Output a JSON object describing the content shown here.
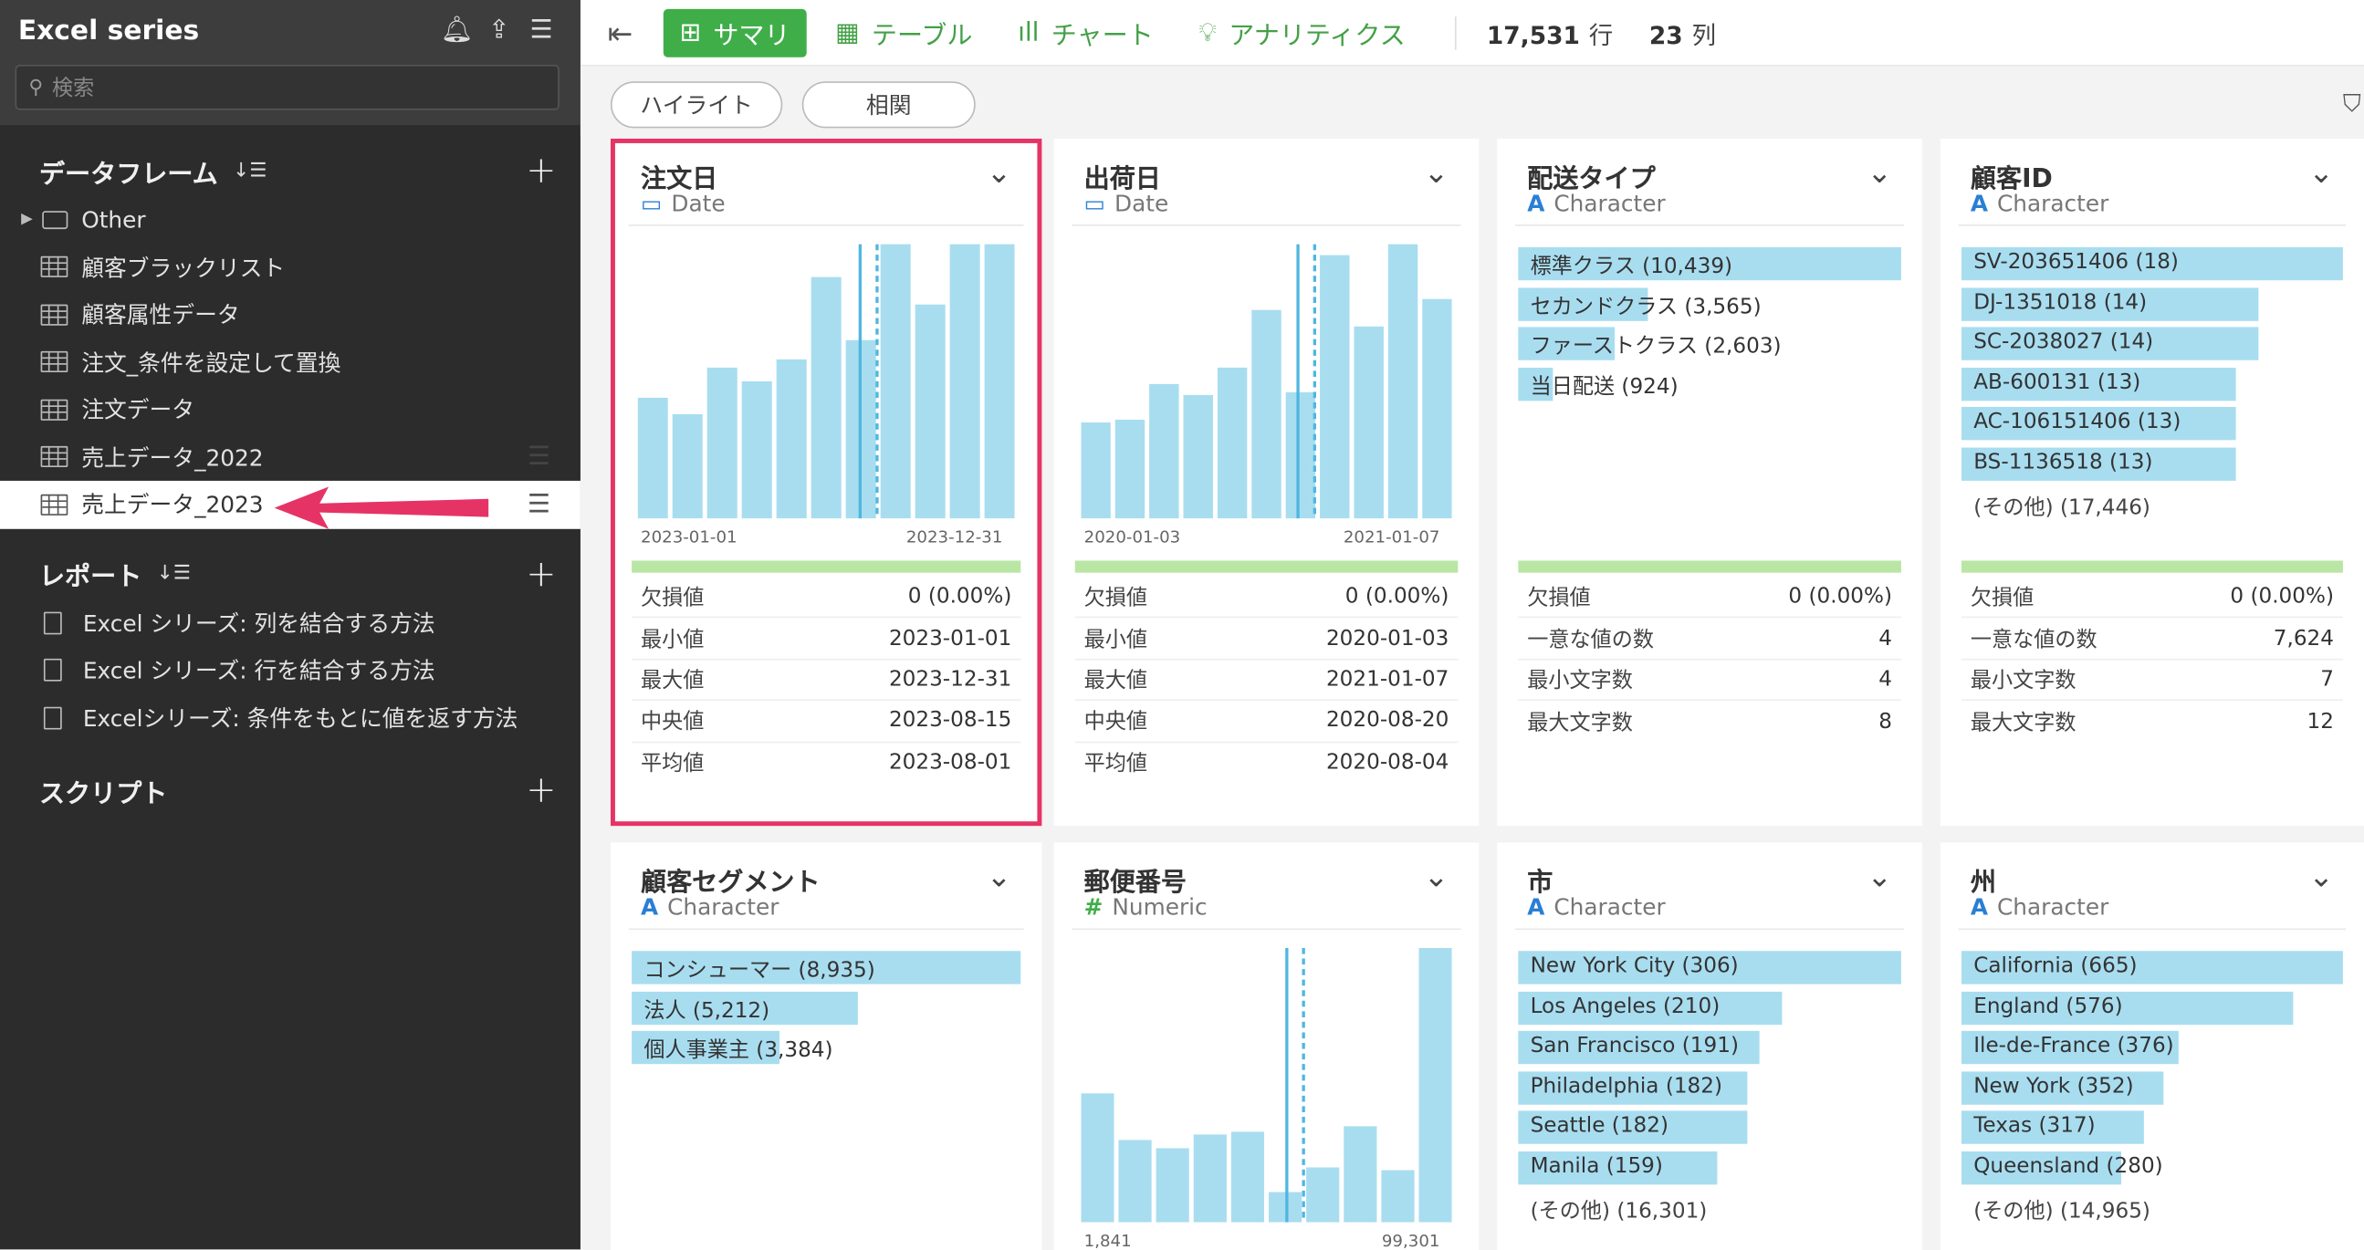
{
  "sidebar": {
    "title": "Excel series",
    "search_placeholder": "検索",
    "dataframes": {
      "title": "データフレーム",
      "items": [
        {
          "label": "Other",
          "kind": "folder"
        },
        {
          "label": "顧客ブラックリスト",
          "kind": "table"
        },
        {
          "label": "顧客属性データ",
          "kind": "table"
        },
        {
          "label": "注文_条件を設定して置換",
          "kind": "table"
        },
        {
          "label": "注文データ",
          "kind": "table"
        },
        {
          "label": "売上データ_2022",
          "kind": "table"
        },
        {
          "label": "売上データ_2023",
          "kind": "table",
          "active": true
        }
      ]
    },
    "reports": {
      "title": "レポート",
      "items": [
        {
          "label": "Excel シリーズ: 列を結合する方法"
        },
        {
          "label": "Excel シリーズ: 行を結合する方法"
        },
        {
          "label": "Excelシリーズ: 条件をもとに値を返す方法"
        }
      ]
    },
    "scripts": {
      "title": "スクリプト"
    }
  },
  "topbar": {
    "tabs": [
      {
        "label": "サマリ",
        "icon": "summary-icon",
        "active": true
      },
      {
        "label": "テーブル",
        "icon": "table-icon"
      },
      {
        "label": "チャート",
        "icon": "bar-chart-icon"
      },
      {
        "label": "アナリティクス",
        "icon": "lightbulb-icon"
      }
    ],
    "rows": "17,531",
    "rows_unit": "行",
    "cols": "23",
    "cols_unit": "列"
  },
  "subbar": {
    "highlight": "ハイライト",
    "correlation": "相関"
  },
  "colors": {
    "accent": "#3fae49",
    "bar": "#a8ddf0",
    "selected": "#e63366",
    "sidebar": "#2c2c2c"
  },
  "cards": [
    {
      "title": "注文日",
      "type": "Date",
      "type_icon": "calendar-icon",
      "hist": {
        "values": [
          44,
          38,
          55,
          50,
          58,
          88,
          65,
          100,
          78,
          100,
          100
        ],
        "median_frac": 0.59,
        "mean_frac": 0.635,
        "x_min": "2023-01-01",
        "x_max": "2023-12-31"
      },
      "stats": [
        {
          "label": "欠損値",
          "value": "0 (0.00%)"
        },
        {
          "label": "最小値",
          "value": "2023-01-01"
        },
        {
          "label": "最大値",
          "value": "2023-12-31"
        },
        {
          "label": "中央値",
          "value": "2023-08-15"
        },
        {
          "label": "平均値",
          "value": "2023-08-01"
        }
      ]
    },
    {
      "title": "出荷日",
      "type": "Date",
      "type_icon": "calendar-icon",
      "hist": {
        "values": [
          35,
          36,
          49,
          45,
          55,
          76,
          46,
          96,
          70,
          100,
          80
        ],
        "median_frac": 0.585,
        "mean_frac": 0.63,
        "x_min": "2020-01-03",
        "x_max": "2021-01-07"
      },
      "stats": [
        {
          "label": "欠損値",
          "value": "0 (0.00%)"
        },
        {
          "label": "最小値",
          "value": "2020-01-03"
        },
        {
          "label": "最大値",
          "value": "2021-01-07"
        },
        {
          "label": "中央値",
          "value": "2020-08-20"
        },
        {
          "label": "平均値",
          "value": "2020-08-04"
        }
      ]
    },
    {
      "title": "配送タイプ",
      "type": "Character",
      "type_icon": "character-icon",
      "categories": [
        {
          "label": "標準クラス (10,439)",
          "frac": 1.0
        },
        {
          "label": "セカンドクラス (3,565)",
          "frac": 0.34
        },
        {
          "label": "ファーストクラス (2,603)",
          "frac": 0.25
        },
        {
          "label": "当日配送 (924)",
          "frac": 0.09
        }
      ],
      "stats": [
        {
          "label": "欠損値",
          "value": "0 (0.00%)"
        },
        {
          "label": "一意な値の数",
          "value": "4"
        },
        {
          "label": "最小文字数",
          "value": "4"
        },
        {
          "label": "最大文字数",
          "value": "8"
        }
      ]
    },
    {
      "title": "顧客ID",
      "type": "Character",
      "type_icon": "character-icon",
      "categories": [
        {
          "label": "SV-203651406 (18)",
          "frac": 1.0
        },
        {
          "label": "DJ-1351018 (14)",
          "frac": 0.78
        },
        {
          "label": "SC-2038027 (14)",
          "frac": 0.78
        },
        {
          "label": "AB-600131 (13)",
          "frac": 0.72
        },
        {
          "label": "AC-106151406 (13)",
          "frac": 0.72
        },
        {
          "label": "BS-1136518 (13)",
          "frac": 0.72
        },
        {
          "label": "(その他) (17,446)",
          "frac": 0,
          "other": true
        }
      ],
      "stats": [
        {
          "label": "欠損値",
          "value": "0 (0.00%)"
        },
        {
          "label": "一意な値の数",
          "value": "7,624"
        },
        {
          "label": "最小文字数",
          "value": "7"
        },
        {
          "label": "最大文字数",
          "value": "12"
        }
      ]
    },
    {
      "title": "顧客セグメント",
      "type": "Character",
      "type_icon": "character-icon",
      "categories": [
        {
          "label": "コンシューマー (8,935)",
          "frac": 1.0
        },
        {
          "label": "法人 (5,212)",
          "frac": 0.58
        },
        {
          "label": "個人事業主 (3,384)",
          "frac": 0.38
        }
      ]
    },
    {
      "title": "郵便番号",
      "type": "Numeric",
      "type_icon": "hash-icon",
      "hist": {
        "values": [
          47,
          30,
          27,
          32,
          33,
          11,
          20,
          35,
          19,
          100
        ],
        "median_frac": 0.555,
        "mean_frac": 0.6,
        "x_min": "1,841",
        "x_max": "99,301"
      }
    },
    {
      "title": "市",
      "type": "Character",
      "type_icon": "character-icon",
      "categories": [
        {
          "label": "New York City (306)",
          "frac": 1.0
        },
        {
          "label": "Los Angeles (210)",
          "frac": 0.69
        },
        {
          "label": "San Francisco (191)",
          "frac": 0.63
        },
        {
          "label": "Philadelphia (182)",
          "frac": 0.6
        },
        {
          "label": "Seattle (182)",
          "frac": 0.6
        },
        {
          "label": "Manila (159)",
          "frac": 0.52
        },
        {
          "label": "(その他) (16,301)",
          "frac": 0,
          "other": true
        }
      ]
    },
    {
      "title": "州",
      "type": "Character",
      "type_icon": "character-icon",
      "categories": [
        {
          "label": "California (665)",
          "frac": 1.0
        },
        {
          "label": "England (576)",
          "frac": 0.87
        },
        {
          "label": "Ile-de-France (376)",
          "frac": 0.57
        },
        {
          "label": "New York (352)",
          "frac": 0.53
        },
        {
          "label": "Texas (317)",
          "frac": 0.48
        },
        {
          "label": "Queensland (280)",
          "frac": 0.42
        },
        {
          "label": "(その他) (14,965)",
          "frac": 0,
          "other": true
        }
      ]
    }
  ]
}
